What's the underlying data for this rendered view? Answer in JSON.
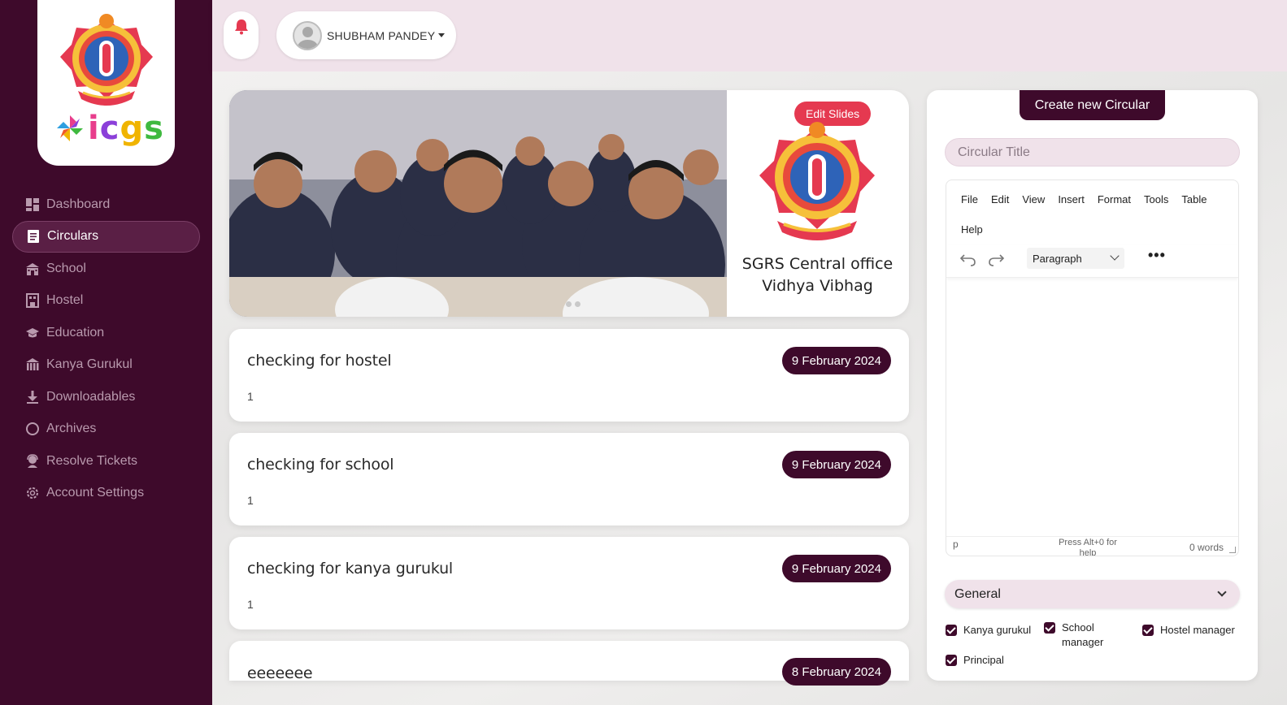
{
  "sidebar": {
    "brand": {
      "i": "i",
      "c": "c",
      "g": "g",
      "s": "s"
    },
    "items": [
      {
        "label": "Dashboard",
        "icon": "dashboard-icon",
        "active": false
      },
      {
        "label": "Circulars",
        "icon": "document-icon",
        "active": true
      },
      {
        "label": "School",
        "icon": "school-icon",
        "active": false
      },
      {
        "label": "Hostel",
        "icon": "hostel-icon",
        "active": false
      },
      {
        "label": "Education",
        "icon": "graduation-cap-icon",
        "active": false
      },
      {
        "label": "Kanya Gurukul",
        "icon": "building-icon",
        "active": false
      },
      {
        "label": "Downloadables",
        "icon": "download-icon",
        "active": false
      },
      {
        "label": "Archives",
        "icon": "circle-icon",
        "active": false
      },
      {
        "label": "Resolve Tickets",
        "icon": "support-icon",
        "active": false
      },
      {
        "label": "Account Settings",
        "icon": "gear-icon",
        "active": false
      }
    ]
  },
  "header": {
    "user_name": "SHUBHAM PANDEY"
  },
  "banner": {
    "edit_label": "Edit Slides",
    "org_line1": "SGRS Central office",
    "org_line2": "Vidhya Vibhag"
  },
  "circulars": [
    {
      "title": "checking for hostel",
      "date": "9 February 2024",
      "body": "1"
    },
    {
      "title": "checking for school",
      "date": "9 February 2024",
      "body": "1"
    },
    {
      "title": "checking for kanya gurukul",
      "date": "9 February 2024",
      "body": "1"
    },
    {
      "title": "eeeeeee",
      "date": "8 February 2024",
      "body": ""
    }
  ],
  "create_panel": {
    "button_label": "Create new Circular",
    "title_placeholder": "Circular Title",
    "editor": {
      "menu": [
        "File",
        "Edit",
        "View",
        "Insert",
        "Format",
        "Tools",
        "Table",
        "Help"
      ],
      "block_format": "Paragraph",
      "more_label": "•••",
      "status_path": "p",
      "status_help": "Press Alt+0 for help",
      "word_count": "0 words"
    },
    "audience_select": "General",
    "recipients": [
      {
        "label": "Kanya gurukul",
        "checked": true
      },
      {
        "label": "School manager",
        "checked": true
      },
      {
        "label": "Hostel manager",
        "checked": true
      },
      {
        "label": "Principal",
        "checked": true
      }
    ]
  },
  "colors": {
    "brand_dark": "#3e0a2b",
    "accent_pink": "#f0e2ea",
    "alert_red": "#e53950"
  }
}
